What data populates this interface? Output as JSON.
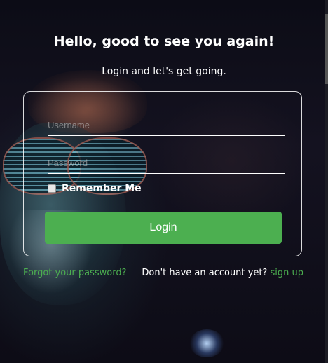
{
  "header": {
    "title": "Hello, good to see you again!",
    "subtitle": "Login and let's get going."
  },
  "form": {
    "username_placeholder": "Username",
    "username_value": "",
    "password_placeholder": "Password",
    "password_value": "",
    "remember_label": "Remember Me",
    "remember_checked": false,
    "login_label": "Login"
  },
  "footer": {
    "forgot_label": "Forgot your password?",
    "signup_prompt": "Don't have an account yet?",
    "signup_label": "sign up"
  },
  "colors": {
    "accent": "#4caf50",
    "text": "#ffffff",
    "background": "#0b0b14"
  }
}
